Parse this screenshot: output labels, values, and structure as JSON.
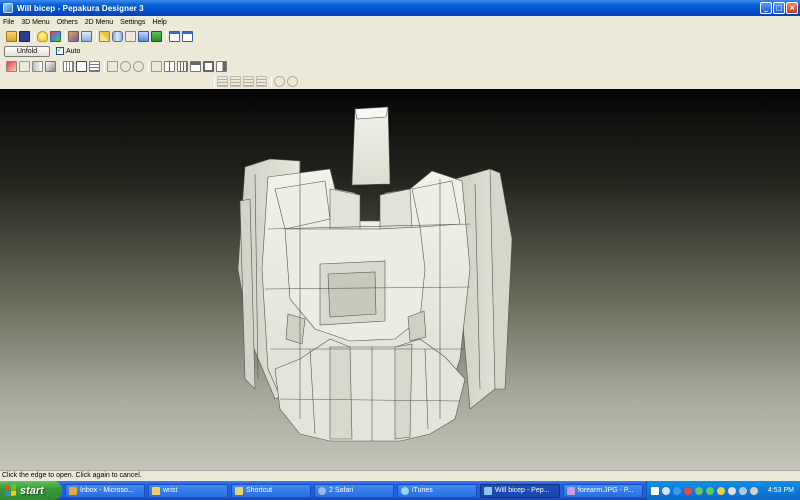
{
  "window": {
    "title": "Will bicep - Pepakura Designer 3",
    "controls": {
      "minimize": "_",
      "maximize": "□",
      "close": "×"
    }
  },
  "menu": [
    "File",
    "3D Menu",
    "Others",
    "2D Menu",
    "Settings",
    "Help"
  ],
  "toolbar": {
    "unfold_label": "Unfold",
    "auto_label": "Auto",
    "auto_checked": true
  },
  "icons": {
    "toolbar1": [
      "open-folder-icon",
      "save-icon",
      "bulb-icon",
      "cube-icon",
      "paint-icon",
      "envelope-icon",
      "pencil-icon",
      "cylinder-icon",
      "anchor-icon",
      "pin-icon",
      "tree-icon",
      "window-left-icon",
      "window-right-icon"
    ],
    "toolbar2": [
      "move-icon",
      "rotate-icon",
      "flip-icon",
      "edge-icon",
      "grid-icon",
      "rect-icon",
      "list-icon",
      "join-icon",
      "rotate-part-icon",
      "undo-icon",
      "check-icon",
      "split-icon",
      "bars-icon",
      "layout-icon",
      "box-icon",
      "column-icon"
    ],
    "toolbar3": [
      "align-left-icon",
      "align-center-icon",
      "align-right-icon",
      "align-justify-icon",
      "rotate-ccw-icon",
      "rotate-cw-icon"
    ]
  },
  "status": {
    "text": "Click the edge to open. Click again to cancel."
  },
  "taskbar": {
    "start_label": "start",
    "tasks": [
      {
        "label": "Inbox - Microso...",
        "icon_color": "#e8a83a",
        "active": false
      },
      {
        "label": "wrist",
        "icon_color": "#f0d070",
        "active": false
      },
      {
        "label": "Shortcut",
        "icon_color": "#f0d070",
        "active": false
      },
      {
        "label": "2 Safari",
        "icon_color": "#9ab8e8",
        "active": false
      },
      {
        "label": "iTunes",
        "icon_color": "#9ad0f0",
        "active": false
      },
      {
        "label": "Will bicep - Pep...",
        "icon_color": "#8ec6f5",
        "active": true
      },
      {
        "label": "forearm.JPG - P...",
        "icon_color": "#c0a0e0",
        "active": false
      }
    ],
    "clock": "4:53 PM",
    "tray_icons": [
      "help-tray-icon",
      "network-tray-icon",
      "ie-tray-icon",
      "antivirus-tray-icon",
      "volume-tray-icon",
      "messenger-tray-icon",
      "shield-tray-icon",
      "update-tray-icon",
      "speaker-tray-icon",
      "printer-tray-icon"
    ]
  },
  "colors": {
    "titlebar_blue": "#0050d0",
    "taskbar_blue": "#245edc",
    "start_green": "#3a9a3a",
    "model_fill": "#e8e8de"
  }
}
